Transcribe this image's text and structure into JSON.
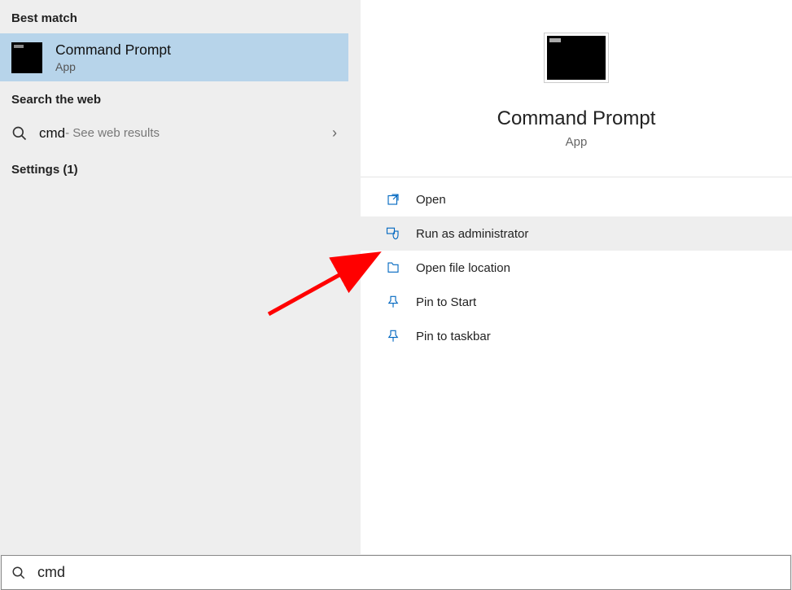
{
  "left": {
    "best_match_header": "Best match",
    "result": {
      "title": "Command Prompt",
      "subtitle": "App"
    },
    "web_header": "Search the web",
    "web": {
      "query": "cmd",
      "hint": " - See web results"
    },
    "settings_header": "Settings (1)"
  },
  "right": {
    "title": "Command Prompt",
    "subtitle": "App",
    "actions": {
      "open": "Open",
      "run_admin": "Run as administrator",
      "open_loc": "Open file location",
      "pin_start": "Pin to Start",
      "pin_taskbar": "Pin to taskbar"
    }
  },
  "search": {
    "value": "cmd"
  }
}
